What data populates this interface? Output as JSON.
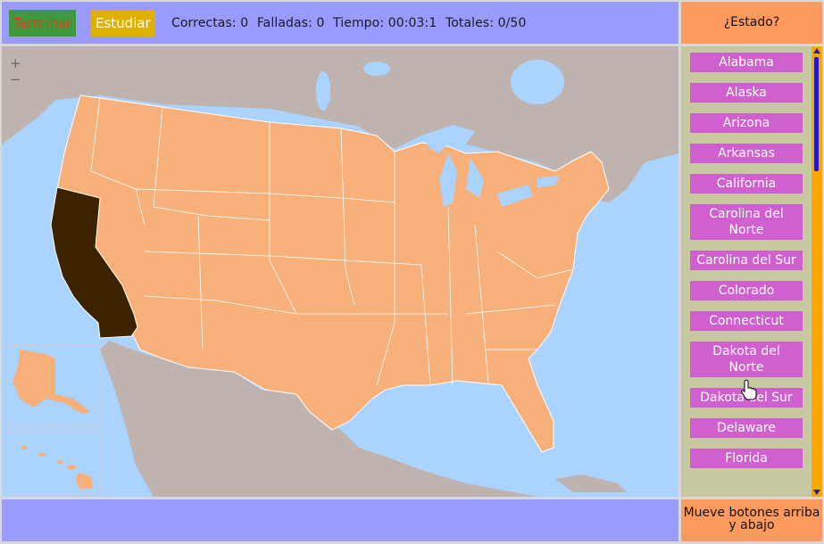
{
  "toolbar": {
    "terminar_label": "Terminar",
    "estudiar_label": "Estudiar"
  },
  "stats": {
    "correctas": "Correctas: 0",
    "falladas": "Falladas: 0",
    "tiempo": "Tiempo: 00:03:1",
    "totales": "Totales: 0/50"
  },
  "status_button": "¿Estado?",
  "map": {
    "zoom_in": "+",
    "zoom_out": "−",
    "highlighted_state": "California",
    "colors": {
      "water": "#aad3ff",
      "land_other": "#bfb3b0",
      "states": "#f8b07a",
      "highlight": "#3d2200",
      "border": "#ffffff"
    }
  },
  "states": [
    "Alabama",
    "Alaska",
    "Arizona",
    "Arkansas",
    "California",
    "Carolina del Norte",
    "Carolina del Sur",
    "Colorado",
    "Connecticut",
    "Dakota del Norte",
    "Dakota del Sur",
    "Delaware",
    "Florida"
  ],
  "hint": "Mueve botones arriba y abajo",
  "colors": {
    "top_bar": "#9a9aff",
    "orange_panel": "#ff9a5e",
    "state_button": "#d060d0",
    "side_panel": "#c8c8a0",
    "scrollbar": "#ffa500"
  }
}
